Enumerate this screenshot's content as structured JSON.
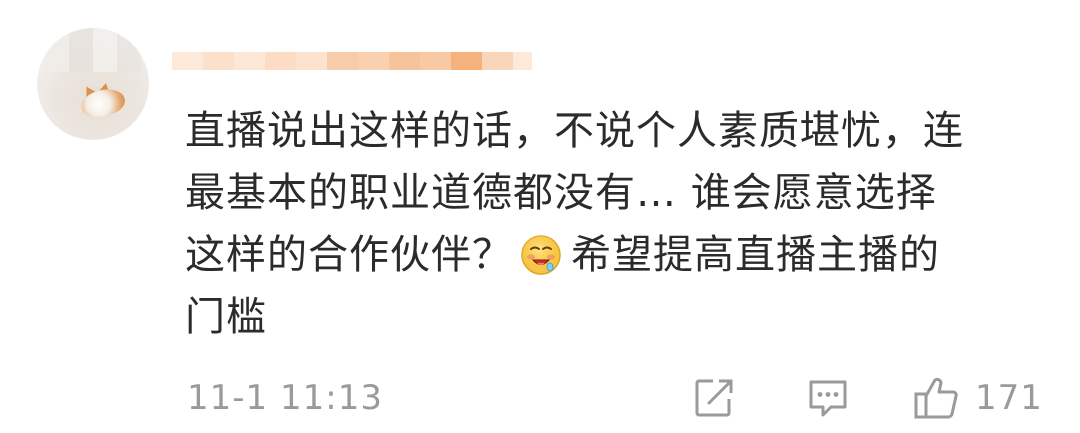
{
  "comment": {
    "text_line1": "直播说出这样的话，不说个人素质堪忧，连",
    "text_line2": "最基本的职业道德都没有… 谁会愿意选择",
    "text_line3a": "这样的合作伙伴？",
    "text_line3b": "希望提高直播主播的",
    "text_line4": "门槛",
    "emoji": "drooling-face-emoji"
  },
  "footer": {
    "timestamp": "11-1 11:13",
    "like_count": "171",
    "share_icon": "share-edit-icon",
    "reply_icon": "comment-bubble-icon",
    "like_icon": "thumbs-up-icon"
  },
  "colors": {
    "text": "#2b2b2b",
    "muted": "#9a9a9a",
    "username_blur": "#f6b67a"
  }
}
